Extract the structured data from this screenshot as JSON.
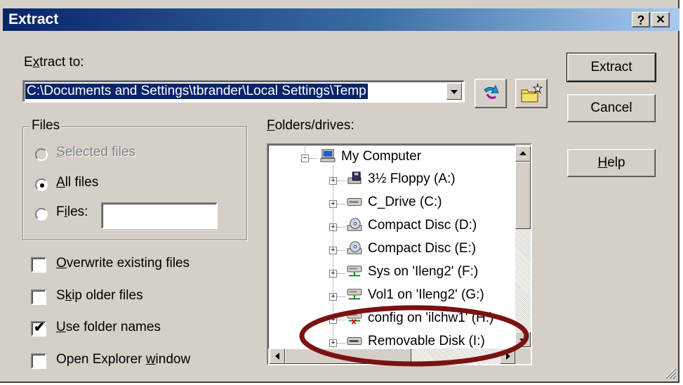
{
  "window": {
    "title": "Extract",
    "help_caption": "?",
    "close_caption": "✕"
  },
  "extract_to": {
    "label_pre": "E",
    "label_mnemonic": "x",
    "label_post": "tract to:",
    "path": "C:\\Documents and Settings\\tbrander\\Local Settings\\Temp"
  },
  "buttons": {
    "extract": "Extract",
    "cancel": "Cancel",
    "help_mnemonic": "H",
    "help_rest": "elp"
  },
  "files_group": {
    "title": "Files",
    "selected_mnemonic": "S",
    "selected_rest": "elected files",
    "all_mnemonic": "A",
    "all_rest": "ll files",
    "files_pre": "F",
    "files_mnemonic": "i",
    "files_post": "les:",
    "files_value": "",
    "selected_option": "all"
  },
  "options": {
    "overwrite_mnemonic": "O",
    "overwrite_rest": "verwrite existing files",
    "overwrite_checked": false,
    "skip_pre": "S",
    "skip_mnemonic": "k",
    "skip_post": "ip older files",
    "skip_checked": false,
    "use_mnemonic": "U",
    "use_rest": "se folder names",
    "use_checked": true,
    "open_pre": "Open Explorer ",
    "open_mnemonic": "w",
    "open_post": "indow",
    "open_checked": false
  },
  "folders": {
    "label_mnemonic": "F",
    "label_rest": "olders/drives:",
    "root": "My Computer",
    "items": [
      {
        "label": "3½ Floppy (A:)",
        "icon": "floppy-drive-icon"
      },
      {
        "label": "C_Drive (C:)",
        "icon": "hard-drive-icon"
      },
      {
        "label": "Compact Disc (D:)",
        "icon": "cd-drive-icon"
      },
      {
        "label": "Compact Disc (E:)",
        "icon": "cd-drive-icon"
      },
      {
        "label": "Sys on 'Ileng2' (F:)",
        "icon": "network-drive-icon"
      },
      {
        "label": "Vol1 on 'Ileng2' (G:)",
        "icon": "network-drive-icon"
      },
      {
        "label": "config on 'ilchw1' (H:)",
        "icon": "disconnected-network-drive-icon"
      },
      {
        "label": "Removable Disk (I:)",
        "icon": "removable-disk-icon"
      }
    ]
  },
  "annotation": {
    "color": "#7a1212"
  },
  "colors": {
    "selection": "#0a246a",
    "face": "#d4d0c8"
  }
}
